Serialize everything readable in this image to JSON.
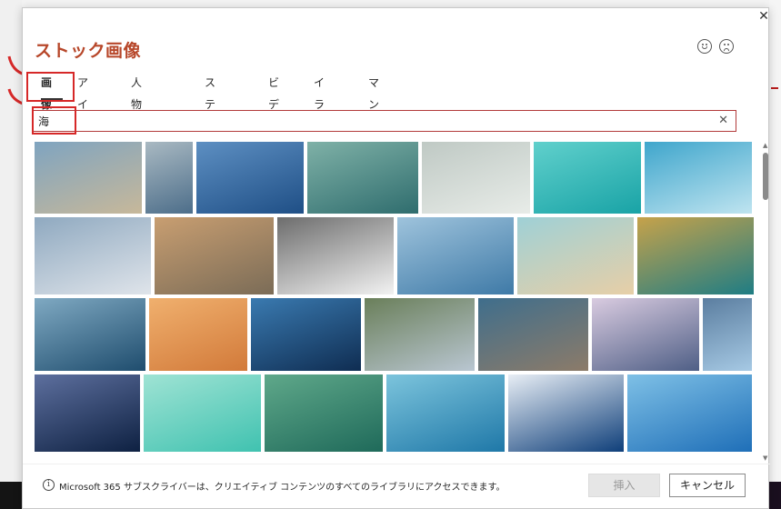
{
  "dialog": {
    "title": "ストック画像",
    "close_glyph": "✕",
    "feedback": [
      "smile-icon",
      "frown-icon"
    ]
  },
  "tabs": [
    {
      "label": "画像",
      "active": true
    },
    {
      "label": "アイコン",
      "active": false
    },
    {
      "label": "人物の切り絵",
      "active": false
    },
    {
      "label": "ステッカー",
      "active": false
    },
    {
      "label": "ビデオ",
      "active": false
    },
    {
      "label": "イラスト",
      "active": false
    },
    {
      "label": "マンガ",
      "active": false
    }
  ],
  "search": {
    "value": "海",
    "clear_glyph": "✕"
  },
  "images": [
    {
      "name": "sandcastle-beach",
      "c1": "#c7b89a",
      "c2": "#7fa4c0"
    },
    {
      "name": "aerial-shore",
      "c1": "#4d6e8a",
      "c2": "#a9b9c2"
    },
    {
      "name": "tuna-school",
      "c1": "#1f4f86",
      "c2": "#5d8fc2"
    },
    {
      "name": "sea-turtle",
      "c1": "#2f6d6e",
      "c2": "#7fb1a7"
    },
    {
      "name": "misty-shore-person",
      "c1": "#e8ece8",
      "c2": "#bfc9c4"
    },
    {
      "name": "turquoise-water",
      "c1": "#19a3a6",
      "c2": "#60d0cc"
    },
    {
      "name": "fisherman-net",
      "c1": "#bfe4f0",
      "c2": "#3fa6cc"
    },
    {
      "name": "flamingo-beach",
      "c1": "#dfe4ea",
      "c2": "#8fa9c0"
    },
    {
      "name": "lighthouse-sunset",
      "c1": "#7b6c57",
      "c2": "#c89e71"
    },
    {
      "name": "sailboats-bw",
      "c1": "#f2f2f2",
      "c2": "#6d6d6d"
    },
    {
      "name": "sand-dunes-aerial",
      "c1": "#3f7aa7",
      "c2": "#9ec3dc"
    },
    {
      "name": "wave-on-sand",
      "c1": "#e7cfa7",
      "c2": "#9fd0d6"
    },
    {
      "name": "coral-closeup",
      "c1": "#1f7d84",
      "c2": "#c6a24a"
    },
    {
      "name": "moonlit-sea",
      "c1": "#1f4d6e",
      "c2": "#7fa9c2"
    },
    {
      "name": "desert-dunes-orange",
      "c1": "#d27a3a",
      "c2": "#f0b06e"
    },
    {
      "name": "fish-school-underwater",
      "c1": "#0f2d52",
      "c2": "#3a7ab0"
    },
    {
      "name": "person-on-rocks",
      "c1": "#b9c6d1",
      "c2": "#6a7f5a"
    },
    {
      "name": "coastal-aerial",
      "c1": "#8c7b69",
      "c2": "#3f6e8c"
    },
    {
      "name": "beluga-dusk",
      "c1": "#4f5f86",
      "c2": "#d9cbe0"
    },
    {
      "name": "child-on-pier",
      "c1": "#a6c9e4",
      "c2": "#5b7ea0"
    },
    {
      "name": "night-sea-moon",
      "c1": "#0e2142",
      "c2": "#5d6f9e"
    },
    {
      "name": "fish-turquoise-aerial",
      "c1": "#40c2b0",
      "c2": "#9fe3d4"
    },
    {
      "name": "seal-kelp-forest",
      "c1": "#1f6a5a",
      "c2": "#5fa88a"
    },
    {
      "name": "manta-aerial",
      "c1": "#1f78a8",
      "c2": "#7cc4dc"
    },
    {
      "name": "curling-wave",
      "c1": "#0f3f7a",
      "c2": "#e8eef5"
    },
    {
      "name": "hammerhead-shark",
      "c1": "#1f6fb8",
      "c2": "#7ec0e6"
    }
  ],
  "footer": {
    "info_text": "Microsoft 365 サブスクライバーは、クリエイティブ コンテンツのすべてのライブラリにアクセスできます。",
    "insert_label": "挿入",
    "cancel_label": "キャンセル"
  }
}
